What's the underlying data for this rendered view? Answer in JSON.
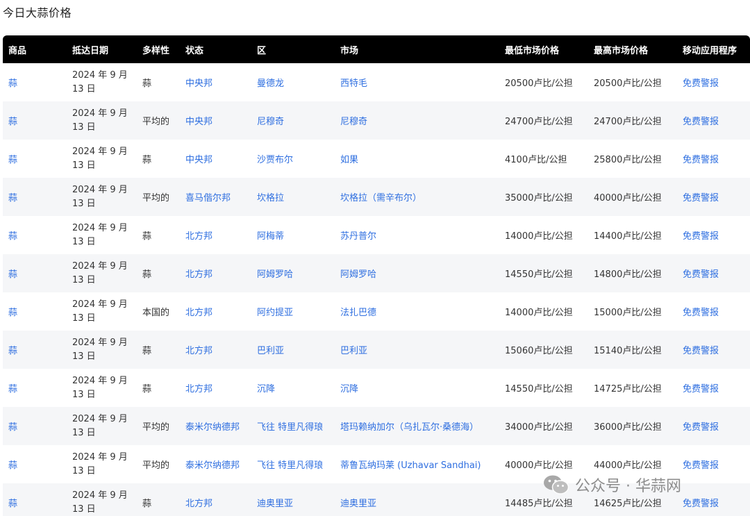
{
  "page": {
    "title": "今日大蒜价格"
  },
  "table": {
    "headers": [
      "商品",
      "抵达日期",
      "多样性",
      "状态",
      "区",
      "市场",
      "最低市场价格",
      "最高市场价格",
      "移动应用程序"
    ],
    "rows": [
      {
        "commodity": "蒜",
        "date": "2024 年 9 月 13 日",
        "variety": "蒜",
        "state": "中央邦",
        "district": "曼德龙",
        "market": "西特毛",
        "min_price": "20500卢比/公担",
        "max_price": "20500卢比/公担",
        "app": "免费警报"
      },
      {
        "commodity": "蒜",
        "date": "2024 年 9 月 13 日",
        "variety": "平均的",
        "state": "中央邦",
        "district": "尼穆奇",
        "market": "尼穆奇",
        "min_price": "24700卢比/公担",
        "max_price": "24700卢比/公担",
        "app": "免费警报"
      },
      {
        "commodity": "蒜",
        "date": "2024 年 9 月 13 日",
        "variety": "蒜",
        "state": "中央邦",
        "district": "沙贾布尔",
        "market": "如果",
        "min_price": "4100卢比/公担",
        "max_price": "25800卢比/公担",
        "app": "免费警报"
      },
      {
        "commodity": "蒜",
        "date": "2024 年 9 月 13 日",
        "variety": "平均的",
        "state": "喜马偕尔邦",
        "district": "坎格拉",
        "market": "坎格拉（需辛布尔）",
        "min_price": "35000卢比/公担",
        "max_price": "40000卢比/公担",
        "app": "免费警报"
      },
      {
        "commodity": "蒜",
        "date": "2024 年 9 月 13 日",
        "variety": "蒜",
        "state": "北方邦",
        "district": "阿梅蒂",
        "market": "苏丹普尔",
        "min_price": "14000卢比/公担",
        "max_price": "14400卢比/公担",
        "app": "免费警报"
      },
      {
        "commodity": "蒜",
        "date": "2024 年 9 月 13 日",
        "variety": "蒜",
        "state": "北方邦",
        "district": "阿姆罗哈",
        "market": "阿姆罗哈",
        "min_price": "14550卢比/公担",
        "max_price": "14800卢比/公担",
        "app": "免费警报"
      },
      {
        "commodity": "蒜",
        "date": "2024 年 9 月 13 日",
        "variety": "本国的",
        "state": "北方邦",
        "district": "阿约提亚",
        "market": "法扎巴德",
        "min_price": "14000卢比/公担",
        "max_price": "15000卢比/公担",
        "app": "免费警报"
      },
      {
        "commodity": "蒜",
        "date": "2024 年 9 月 13 日",
        "variety": "蒜",
        "state": "北方邦",
        "district": "巴利亚",
        "market": "巴利亚",
        "min_price": "15060卢比/公担",
        "max_price": "15140卢比/公担",
        "app": "免费警报"
      },
      {
        "commodity": "蒜",
        "date": "2024 年 9 月 13 日",
        "variety": "蒜",
        "state": "北方邦",
        "district": "沉降",
        "market": "沉降",
        "min_price": "14550卢比/公担",
        "max_price": "14725卢比/公担",
        "app": "免费警报"
      },
      {
        "commodity": "蒜",
        "date": "2024 年 9 月 13 日",
        "variety": "平均的",
        "state": "泰米尔纳德邦",
        "district": "飞往 特里凡得琅",
        "market": "塔玛赖纳加尔（乌扎瓦尔·桑德海）",
        "min_price": "34000卢比/公担",
        "max_price": "36000卢比/公担",
        "app": "免费警报"
      },
      {
        "commodity": "蒜",
        "date": "2024 年 9 月 13 日",
        "variety": "平均的",
        "state": "泰米尔纳德邦",
        "district": "飞往 特里凡得琅",
        "market": "蒂鲁瓦纳玛莱 (Uzhavar Sandhai)",
        "min_price": "40000卢比/公担",
        "max_price": "44000卢比/公担",
        "app": "免费警报"
      },
      {
        "commodity": "蒜",
        "date": "2024 年 9 月 13 日",
        "variety": "蒜",
        "state": "北方邦",
        "district": "迪奥里亚",
        "market": "迪奥里亚",
        "min_price": "14485卢比/公担",
        "max_price": "14625卢比/公担",
        "app": "免费警报"
      }
    ]
  },
  "watermark": {
    "text": "公众号 · 华蒜网",
    "icon": "wechat-icon"
  }
}
